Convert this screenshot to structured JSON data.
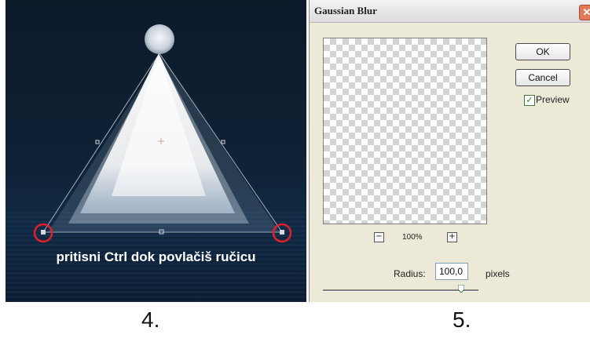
{
  "step4": {
    "instruction": "pritisni Ctrl dok povlačiš ručicu",
    "step_number": "4."
  },
  "dialog": {
    "title": "Gaussian Blur",
    "close_glyph": "✕",
    "ok_label": "OK",
    "cancel_label": "Cancel",
    "preview_label": "Preview",
    "preview_checked": true,
    "zoom_out_glyph": "−",
    "zoom_in_glyph": "+",
    "zoom_level": "100%",
    "radius_label": "Radius:",
    "radius_value": "100,0",
    "radius_unit": "pixels",
    "radius_slider_fraction": 0.89
  },
  "step5": {
    "step_number": "5."
  },
  "colors": {
    "handle_highlight": "#e0202a",
    "dialog_bg": "#ece9d8",
    "close_button": "#e07a5a"
  }
}
